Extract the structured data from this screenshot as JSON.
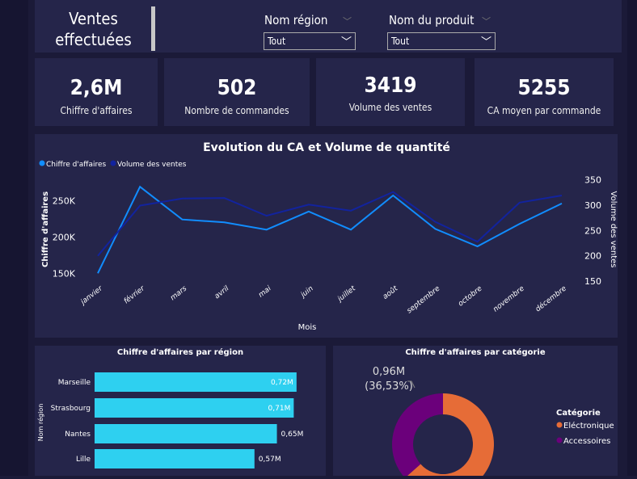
{
  "header": {
    "title_line1": "Ventes",
    "title_line2": "effectuées"
  },
  "filters": [
    {
      "label": "Nom région",
      "value": "Tout"
    },
    {
      "label": "Nom du produit",
      "value": "Tout"
    }
  ],
  "kpis": [
    {
      "value": "2,6M",
      "label": "Chiffre d'affaires"
    },
    {
      "value": "502",
      "label": "Nombre de commandes"
    },
    {
      "value": "3419",
      "label": "Volume des ventes"
    },
    {
      "value": "5255",
      "label": "CA moyen par commande"
    }
  ],
  "chart_data": [
    {
      "type": "line",
      "title": "Evolution du CA et Volume de quantité",
      "xlabel": "Mois",
      "ylabel": "Chiffre d'affaires",
      "y2label": "Volume des ventes",
      "categories": [
        "janvier",
        "février",
        "mars",
        "avril",
        "mai",
        "juin",
        "juillet",
        "août",
        "septembre",
        "octobre",
        "novembre",
        "décembre"
      ],
      "ylim": [
        137000,
        287000
      ],
      "y2lim": [
        147,
        362
      ],
      "yticks": [
        {
          "v": 150000,
          "t": "150K"
        },
        {
          "v": 200000,
          "t": "200K"
        },
        {
          "v": 250000,
          "t": "250K"
        }
      ],
      "y2ticks": [
        150,
        200,
        250,
        300,
        350
      ],
      "legend": "top-left",
      "series": [
        {
          "name": "Chiffre d'affaires",
          "axis": "left",
          "color": "#118dff",
          "values": [
            150000,
            269000,
            224000,
            220000,
            210000,
            235000,
            210000,
            257000,
            211000,
            187000,
            218000,
            246000
          ]
        },
        {
          "name": "Volume des ventes",
          "axis": "right",
          "color": "#12239e",
          "values": [
            200,
            299,
            313,
            314,
            279,
            301,
            289,
            326,
            267,
            228,
            305,
            319
          ]
        }
      ]
    },
    {
      "type": "bar",
      "title": "Chiffre d'affaires par région",
      "ylabel": "Nom région",
      "color": "#2ed0f0",
      "categories": [
        "Marseille",
        "Strasbourg",
        "Nantes",
        "Lille"
      ],
      "values": [
        0.72,
        0.71,
        0.65,
        0.57
      ],
      "labels": [
        "0,72M",
        "0,71M",
        "0,65M",
        "0,57M"
      ]
    },
    {
      "type": "pie",
      "title": "Chiffre d'affaires par catégorie",
      "legend_title": "Catégorie",
      "slices": [
        {
          "name": "Eléctronique",
          "percent": 63.47,
          "color": "#e66c37"
        },
        {
          "name": "Accessoires",
          "percent": 36.53,
          "color": "#6b007b"
        }
      ],
      "annotation_value": "0,96M",
      "annotation_pct": "(36,53%)"
    }
  ]
}
